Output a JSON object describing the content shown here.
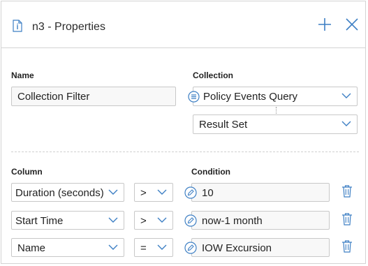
{
  "dialog": {
    "title": "n3 - Properties",
    "title_icon": "document-info-icon",
    "add_icon": "plus-icon",
    "close_icon": "close-icon"
  },
  "name_field": {
    "label": "Name",
    "value": "Collection Filter"
  },
  "collection": {
    "label": "Collection",
    "query_value": "Policy Events Query",
    "query_icon": "list-icon",
    "result_value": "Result Set"
  },
  "columns_header": "Column",
  "condition_header": "Condition",
  "rows": [
    {
      "column": "Duration (seconds)",
      "operator": ">",
      "value": "10"
    },
    {
      "column": "Start Time",
      "operator": ">",
      "value": "now-1 month"
    },
    {
      "column": "Name",
      "operator": "=",
      "value": "IOW Excursion"
    }
  ],
  "colors": {
    "accent": "#3d7fc4",
    "border": "#c8c8c8"
  }
}
